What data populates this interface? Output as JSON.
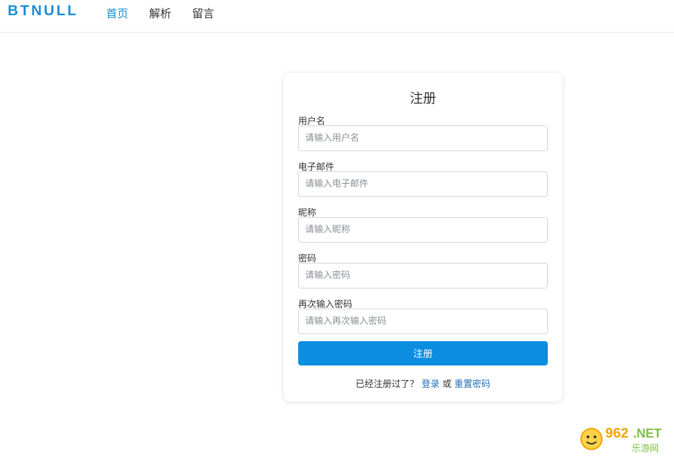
{
  "header": {
    "brand": "BTNULL",
    "nav": [
      {
        "label": "首页",
        "active": true
      },
      {
        "label": "解析",
        "active": false
      },
      {
        "label": "留言",
        "active": false
      }
    ]
  },
  "form": {
    "title": "注册",
    "fields": [
      {
        "label": "用户名",
        "placeholder": "请输入用户名",
        "value": ""
      },
      {
        "label": "电子邮件",
        "placeholder": "请输入电子邮件",
        "value": ""
      },
      {
        "label": "昵称",
        "placeholder": "请输入昵称",
        "value": ""
      },
      {
        "label": "密码",
        "placeholder": "请输入密码",
        "value": ""
      },
      {
        "label": "再次输入密码",
        "placeholder": "请输入再次输入密码",
        "value": ""
      }
    ],
    "submit_label": "注册",
    "footer": {
      "prefix": "已经注册过了？",
      "login_link": "登录",
      "or": "或",
      "reset_link": "重置密码"
    }
  },
  "watermark": {
    "text_main": "962.NET",
    "text_sub": "乐游网"
  },
  "colors": {
    "accent": "#1a8fd6",
    "button": "#0b8ee0",
    "link": "#1f6fb5"
  }
}
